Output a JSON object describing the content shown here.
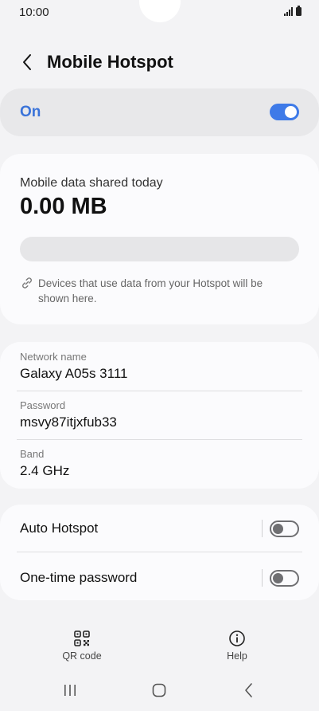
{
  "status_bar": {
    "time": "10:00"
  },
  "header": {
    "title": "Mobile Hotspot"
  },
  "hotspot": {
    "state_label": "On",
    "enabled": true
  },
  "usage": {
    "caption": "Mobile data shared today",
    "amount": "0.00 MB",
    "progress_fraction": 0,
    "devices_note": "Devices that use data from your Hotspot will be shown here."
  },
  "network": {
    "name_label": "Network name",
    "name_value": "Galaxy A05s 3111",
    "password_label": "Password",
    "password_value": "msvy87itjxfub33",
    "band_label": "Band",
    "band_value": "2.4 GHz"
  },
  "settings": {
    "auto_hotspot_label": "Auto Hotspot",
    "auto_hotspot_enabled": false,
    "one_time_password_label": "One-time password",
    "one_time_password_enabled": false
  },
  "bottom_actions": {
    "qr_label": "QR code",
    "help_label": "Help"
  },
  "colors": {
    "accent": "#3e7ae8",
    "on_text": "#3a73d9",
    "background": "#f3f3f5",
    "card": "#fbfbfd"
  },
  "icons": [
    "back-arrow-icon",
    "signal-icon",
    "battery-icon",
    "link-icon",
    "qr-code-icon",
    "help-icon",
    "recent-apps-icon",
    "home-icon",
    "nav-back-icon"
  ]
}
